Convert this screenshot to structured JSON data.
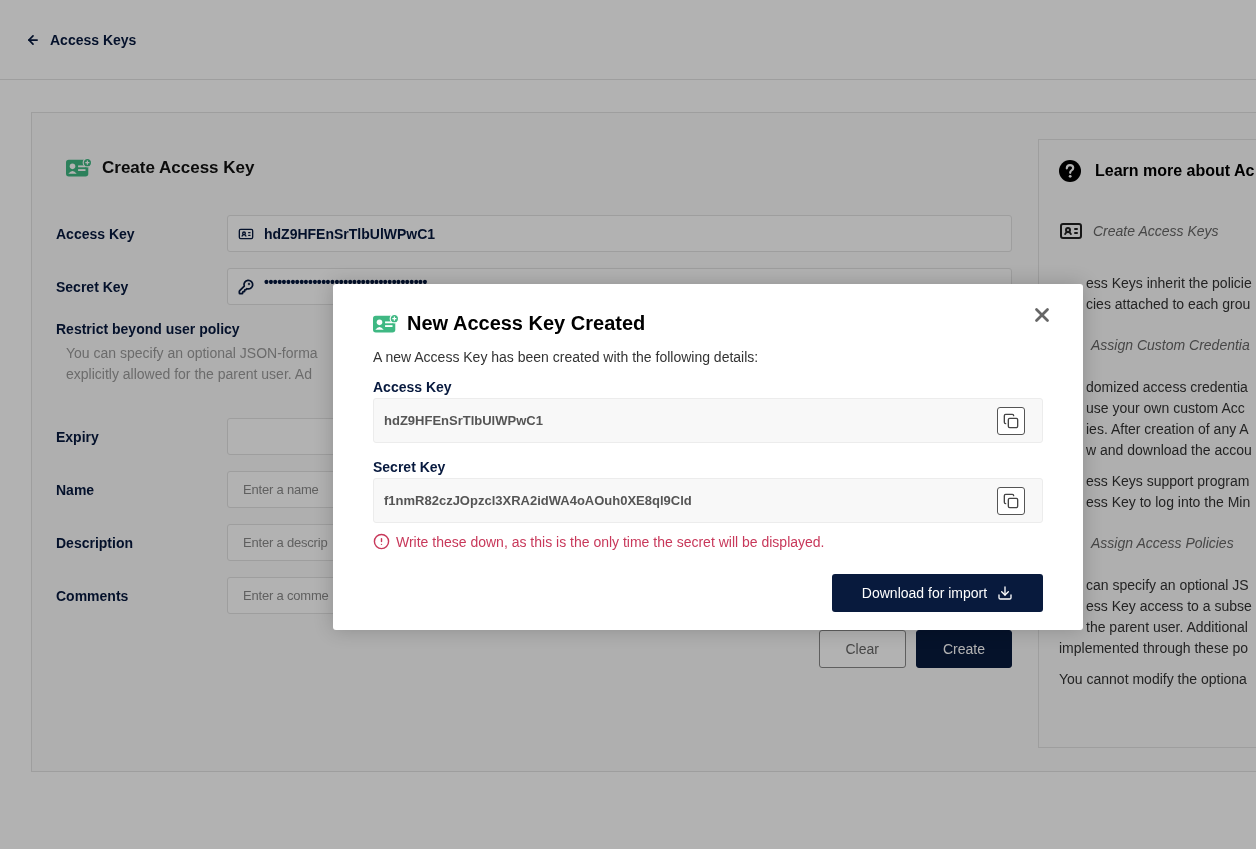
{
  "header": {
    "back_label": "Access Keys"
  },
  "form": {
    "title": "Create Access Key",
    "key_fields": [
      {
        "label": "Access Key",
        "kind": "access",
        "value": "hdZ9HFEnSrTlbUlWPwC1"
      },
      {
        "label": "Secret Key",
        "kind": "secret",
        "value": "•••••••••••••••••••••••••••••••••••••"
      }
    ],
    "restrict": {
      "title": "Restrict beyond user policy",
      "lines": [
        "You can specify an optional JSON-forma",
        "explicitly allowed for the parent user. Ad"
      ]
    },
    "fields": [
      {
        "label": "Expiry",
        "clipped": true
      },
      {
        "label": "Name",
        "placeholder": "Enter a name",
        "clipped": true
      },
      {
        "label": "Description",
        "placeholder": "Enter a descrip",
        "clipped": true
      },
      {
        "label": "Comments",
        "placeholder": "Enter a comme",
        "clipped": true
      }
    ],
    "buttons": [
      {
        "label": "Clear",
        "kind": "secondary"
      },
      {
        "label": "Create",
        "kind": "primary"
      }
    ]
  },
  "help": {
    "title": "Learn more about Ac",
    "lines": [
      {
        "kind": "heading",
        "text": "Create Access Keys",
        "clipped": false
      },
      {
        "kind": "text",
        "text": "ess Keys inherit the policie",
        "clipped": true
      },
      {
        "kind": "text",
        "text": "cies attached to each grou",
        "clipped": true
      },
      {
        "kind": "heading",
        "text": "Assign Custom Credentia",
        "clipped": true
      },
      {
        "kind": "text",
        "text": "domized access credentia",
        "clipped": true
      },
      {
        "kind": "text",
        "text": "use your own custom Acc",
        "clipped": true
      },
      {
        "kind": "text",
        "text": "ies. After creation of any A",
        "clipped": true
      },
      {
        "kind": "text",
        "text": "w and download the accou",
        "clipped": true
      },
      {
        "kind": "gap",
        "text": "ess Keys support program",
        "clipped": true
      },
      {
        "kind": "text",
        "text": "ess Key to log into the Min",
        "clipped": true
      },
      {
        "kind": "heading",
        "text": "Assign Access Policies",
        "clipped": true
      },
      {
        "kind": "text",
        "text": "can specify an optional JS",
        "clipped": true
      },
      {
        "kind": "text",
        "text": "ess Key access to a subse",
        "clipped": true
      },
      {
        "kind": "text",
        "text": "the parent user. Additional",
        "clipped": true
      },
      {
        "kind": "text",
        "text": "implemented through these po",
        "clipped": false
      },
      {
        "kind": "gap",
        "text": "You cannot modify the optiona",
        "clipped": false
      }
    ]
  },
  "modal": {
    "title": "New Access Key Created",
    "subtitle": "A new Access Key has been created with the following details:",
    "keys": [
      {
        "label": "Access Key",
        "value": "hdZ9HFEnSrTlbUlWPwC1"
      },
      {
        "label": "Secret Key",
        "value": "f1nmR82czJOpzcl3XRA2idWA4oAOuh0XE8ql9Cld"
      }
    ],
    "warning": "Write these down, as this is the only time the secret will be displayed.",
    "download_label": "Download for import"
  }
}
